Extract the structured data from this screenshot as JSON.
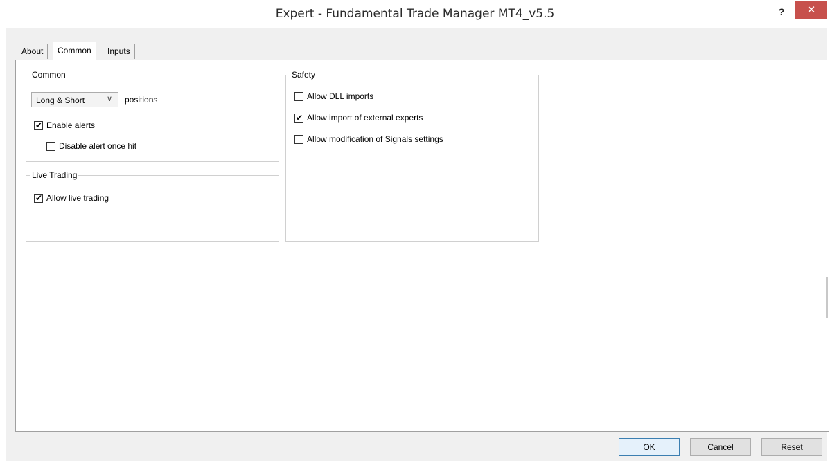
{
  "window": {
    "title": "Expert - Fundamental Trade Manager MT4_v5.5",
    "help_label": "?",
    "close_label": "✕"
  },
  "tabs": [
    {
      "label": "About",
      "active": false
    },
    {
      "label": "Common",
      "active": true
    },
    {
      "label": "Inputs",
      "active": false
    }
  ],
  "common": {
    "title": "Common",
    "positions_select": {
      "value": "Long & Short",
      "arrow": "∨"
    },
    "positions_label": "positions",
    "enable_alerts": {
      "label": "Enable alerts",
      "checked": true
    },
    "disable_alert_once_hit": {
      "label": "Disable alert once hit",
      "checked": false
    }
  },
  "live_trading": {
    "title": "Live Trading",
    "allow_live_trading": {
      "label": "Allow live trading",
      "checked": true
    }
  },
  "safety": {
    "title": "Safety",
    "allow_dll_imports": {
      "label": "Allow DLL imports",
      "checked": false
    },
    "allow_external_experts": {
      "label": "Allow import of external experts",
      "checked": true
    },
    "allow_signals_modification": {
      "label": "Allow modification of Signals settings",
      "checked": false
    }
  },
  "buttons": {
    "ok": "OK",
    "cancel": "Cancel",
    "reset": "Reset"
  },
  "checkmark": "✔"
}
